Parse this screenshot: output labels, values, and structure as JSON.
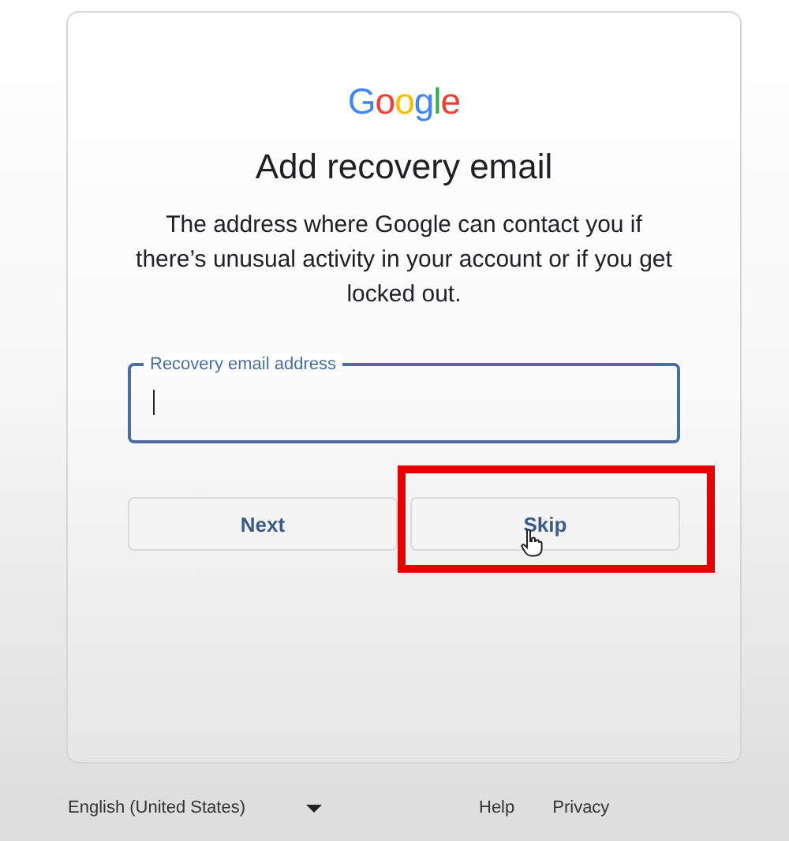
{
  "card": {
    "logo": "Google",
    "title": "Add recovery email",
    "description": "The address where Google can contact you if there’s unusual activity in your account or if you get locked out.",
    "field": {
      "label": "Recovery email address",
      "focused": true
    },
    "buttons": [
      {
        "label": "Next",
        "highlighted": false
      },
      {
        "label": "Skip",
        "highlighted": true
      }
    ]
  },
  "footer": {
    "language": "English (United States)",
    "links": [
      "Help",
      "Privacy"
    ]
  }
}
